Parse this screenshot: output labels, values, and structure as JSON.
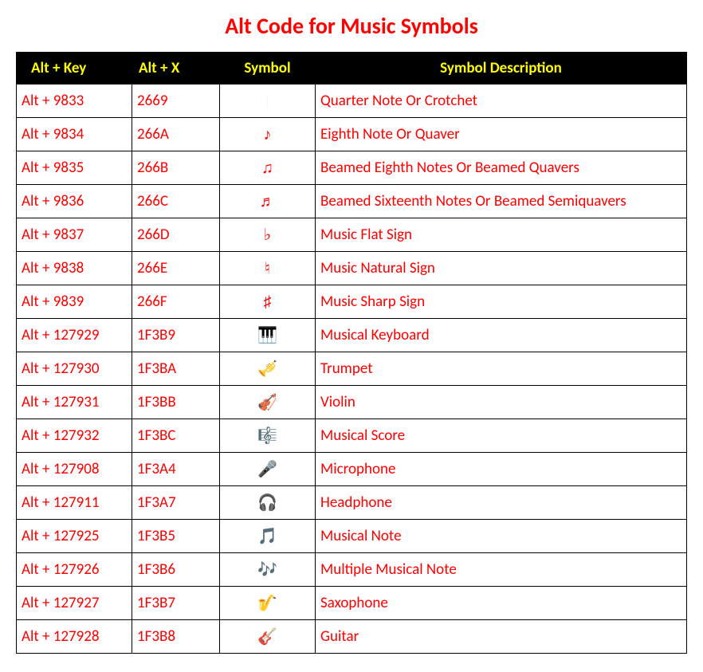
{
  "title": "Alt Code for Music Symbols",
  "columns": {
    "altkey": "Alt + Key",
    "altx": "Alt + X",
    "symbol": "Symbol",
    "desc": "Symbol Description"
  },
  "rows": [
    {
      "altkey": "Alt + 9833",
      "altx": "2669",
      "symbol": "♩",
      "desc": "Quarter Note Or Crotchet"
    },
    {
      "altkey": "Alt + 9834",
      "altx": "266A",
      "symbol": "♪",
      "desc": "Eighth Note Or Quaver"
    },
    {
      "altkey": "Alt + 9835",
      "altx": "266B",
      "symbol": "♫",
      "desc": "Beamed Eighth Notes Or Beamed Quavers"
    },
    {
      "altkey": "Alt + 9836",
      "altx": "266C",
      "symbol": "♬",
      "desc": "Beamed Sixteenth Notes Or Beamed Semiquavers"
    },
    {
      "altkey": "Alt + 9837",
      "altx": "266D",
      "symbol": "♭",
      "desc": "Music Flat Sign"
    },
    {
      "altkey": "Alt + 9838",
      "altx": "266E",
      "symbol": "♮",
      "desc": "Music Natural Sign"
    },
    {
      "altkey": "Alt + 9839",
      "altx": "266F",
      "symbol": "♯",
      "desc": "Music Sharp Sign"
    },
    {
      "altkey": "Alt + 127929",
      "altx": "1F3B9",
      "symbol": "🎹",
      "desc": "Musical Keyboard"
    },
    {
      "altkey": "Alt + 127930",
      "altx": "1F3BA",
      "symbol": "🎺",
      "desc": "Trumpet"
    },
    {
      "altkey": "Alt + 127931",
      "altx": "1F3BB",
      "symbol": "🎻",
      "desc": "Violin"
    },
    {
      "altkey": "Alt + 127932",
      "altx": "1F3BC",
      "symbol": "🎼",
      "desc": "Musical Score"
    },
    {
      "altkey": "Alt + 127908",
      "altx": "1F3A4",
      "symbol": "🎤",
      "desc": "Microphone"
    },
    {
      "altkey": "Alt + 127911",
      "altx": "1F3A7",
      "symbol": "🎧",
      "desc": "Headphone"
    },
    {
      "altkey": "Alt + 127925",
      "altx": "1F3B5",
      "symbol": "🎵",
      "desc": "Musical Note"
    },
    {
      "altkey": "Alt + 127926",
      "altx": "1F3B6",
      "symbol": "🎶",
      "desc": "Multiple Musical Note"
    },
    {
      "altkey": "Alt + 127927",
      "altx": "1F3B7",
      "symbol": "🎷",
      "desc": "Saxophone"
    },
    {
      "altkey": "Alt + 127928",
      "altx": "1F3B8",
      "symbol": "🎸",
      "desc": "Guitar"
    }
  ]
}
